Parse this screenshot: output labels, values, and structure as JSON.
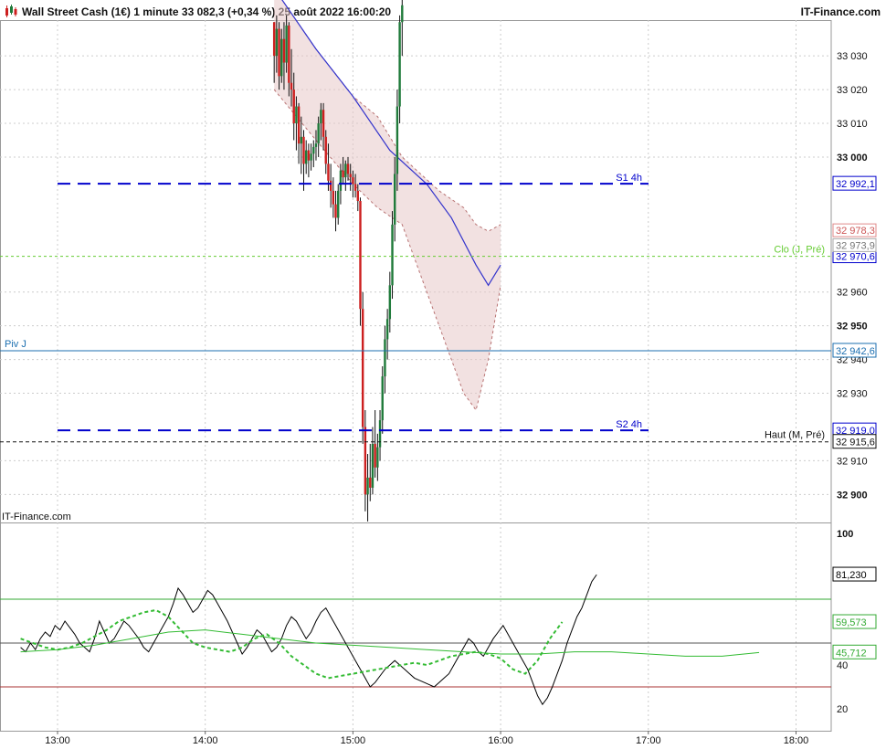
{
  "header": {
    "title": "Wall Street Cash (1€) 1 minute 33 082,3 (+0,34 %) 25 août 2022 16:00:20",
    "brand": "IT-Finance.com",
    "watermark": "IT-Finance.com"
  },
  "colors": {
    "up": "#1f7a3a",
    "down": "#cc1f1f",
    "mavg": "#3333cc",
    "pivot": "#1c6fb0",
    "level": "#0000cc",
    "close_line": "#66cc33",
    "bands": "#b87272",
    "osc": "#000000",
    "osc_fast": "#33bb33",
    "osc_slow": "#cc3333"
  },
  "chart_data": [
    {
      "type": "candlestick",
      "title": "Wall Street Cash (1€) 1 minute",
      "x_ticks": [
        "13:00",
        "14:00",
        "15:00",
        "16:00",
        "17:00",
        "18:00"
      ],
      "y_ticks": [
        {
          "v": 33030,
          "label": "33 030",
          "bold": false
        },
        {
          "v": 33020,
          "label": "33 020",
          "bold": false
        },
        {
          "v": 33010,
          "label": "33 010",
          "bold": false
        },
        {
          "v": 33000,
          "label": "33 000",
          "bold": true
        },
        {
          "v": 32960,
          "label": "32 960",
          "bold": false
        },
        {
          "v": 32950,
          "label": "32 950",
          "bold": true
        },
        {
          "v": 32940,
          "label": "32 940",
          "bold": false
        },
        {
          "v": 32930,
          "label": "32 930",
          "bold": false
        },
        {
          "v": 32910,
          "label": "32 910",
          "bold": false
        },
        {
          "v": 32900,
          "label": "32 900",
          "bold": true
        }
      ],
      "ylim": [
        32891.7,
        33040.6
      ],
      "levels": [
        {
          "name": "S1 4h",
          "value": 32992.1,
          "label": "32 992,1",
          "style": "dashed-blue"
        },
        {
          "name": "S2 4h",
          "value": 32919.0,
          "label": "32 919,0",
          "style": "dashed-blue"
        },
        {
          "name": "Clo (J, Pré)",
          "value": 32970.6,
          "label": "32 970,6",
          "style": "dotted-green"
        },
        {
          "name": "Piv J",
          "value": 32942.6,
          "label": "32 942,6",
          "style": "solid-pivot"
        },
        {
          "name": "Haut (M, Pré)",
          "value": 32915.6,
          "label": "32 915,6",
          "style": "dashed-black"
        }
      ],
      "extra_labels": [
        {
          "value": 32978.3,
          "label": "32 978,3"
        },
        {
          "value": 32973.9,
          "label": "32 973,9"
        }
      ],
      "candles_start": "14:28",
      "candles": [
        [
          33040,
          33040,
          33022,
          33030
        ],
        [
          33030,
          33042,
          33025,
          33038
        ],
        [
          33038,
          33040,
          33020,
          33024
        ],
        [
          33024,
          33038,
          33022,
          33035
        ],
        [
          33035,
          33040,
          33020,
          33028
        ],
        [
          33028,
          33042,
          33025,
          33039
        ],
        [
          33039,
          33040,
          33018,
          33022
        ],
        [
          33022,
          33032,
          33015,
          33020
        ],
        [
          33020,
          33025,
          33005,
          33010
        ],
        [
          33010,
          33018,
          33002,
          33015
        ],
        [
          33015,
          33016,
          32998,
          33004
        ],
        [
          33004,
          33012,
          32995,
          33006
        ],
        [
          33006,
          33008,
          32990,
          32998
        ],
        [
          32998,
          33005,
          32995,
          33002
        ],
        [
          33002,
          33004,
          32994,
          32999
        ],
        [
          32999,
          33004,
          32996,
          33001
        ],
        [
          33001,
          33005,
          32997,
          33003
        ],
        [
          33003,
          33008,
          32999,
          33004
        ],
        [
          33004,
          33012,
          33000,
          33010
        ],
        [
          33010,
          33016,
          33005,
          33014
        ],
        [
          33014,
          33016,
          33002,
          33006
        ],
        [
          33006,
          33008,
          32995,
          32998
        ],
        [
          32998,
          33004,
          32990,
          32993
        ],
        [
          32993,
          32998,
          32985,
          32990
        ],
        [
          32990,
          32994,
          32982,
          32986
        ],
        [
          32986,
          32990,
          32978,
          32982
        ],
        [
          32982,
          32992,
          32980,
          32990
        ],
        [
          32990,
          32998,
          32986,
          32996
        ],
        [
          32996,
          33000,
          32992,
          32994
        ],
        [
          32994,
          32999,
          32990,
          32998
        ],
        [
          32998,
          33000,
          32993,
          32995
        ],
        [
          32995,
          32998,
          32990,
          32994
        ],
        [
          32994,
          32996,
          32988,
          32992
        ],
        [
          32992,
          32995,
          32988,
          32990
        ],
        [
          32990,
          32992,
          32984,
          32987
        ],
        [
          32987,
          32988,
          32950,
          32955
        ],
        [
          32955,
          32960,
          32915,
          32920
        ],
        [
          32920,
          32925,
          32895,
          32900
        ],
        [
          32900,
          32912,
          32892,
          32905
        ],
        [
          32905,
          32915,
          32898,
          32902
        ],
        [
          32902,
          32920,
          32900,
          32915
        ],
        [
          32915,
          32925,
          32905,
          32908
        ],
        [
          32908,
          32918,
          32904,
          32914
        ],
        [
          32914,
          32925,
          32910,
          32922
        ],
        [
          32922,
          32938,
          32918,
          32935
        ],
        [
          32935,
          32950,
          32930,
          32946
        ],
        [
          32946,
          32955,
          32940,
          32952
        ],
        [
          32952,
          32966,
          32948,
          32962
        ],
        [
          32962,
          32984,
          32958,
          32980
        ],
        [
          32980,
          33000,
          32975,
          32995
        ],
        [
          32995,
          33020,
          32990,
          33015
        ],
        [
          33015,
          33042,
          33010,
          33040
        ],
        [
          33040,
          33050,
          33030,
          33045
        ]
      ],
      "mavg": [
        [
          "14:28",
          33050
        ],
        [
          "14:45",
          33032
        ],
        [
          "15:00",
          33018
        ],
        [
          "15:15",
          33002
        ],
        [
          "15:30",
          32992
        ],
        [
          "15:40",
          32982
        ],
        [
          "15:50",
          32968
        ],
        [
          "15:55",
          32962
        ],
        [
          "16:00",
          32968
        ]
      ],
      "band_upper": [
        [
          "14:28",
          33050
        ],
        [
          "14:45",
          33032
        ],
        [
          "15:00",
          33018
        ],
        [
          "15:10",
          33012
        ],
        [
          "15:20",
          33000
        ],
        [
          "15:35",
          32990
        ],
        [
          "15:45",
          32985
        ],
        [
          "15:50",
          32980
        ],
        [
          "15:55",
          32978
        ],
        [
          "16:00",
          32980
        ]
      ],
      "band_lower": [
        [
          "14:28",
          33020
        ],
        [
          "14:45",
          33005
        ],
        [
          "15:00",
          32992
        ],
        [
          "15:10",
          32985
        ],
        [
          "15:20",
          32980
        ],
        [
          "15:35",
          32950
        ],
        [
          "15:45",
          32930
        ],
        [
          "15:50",
          32925
        ],
        [
          "15:55",
          32940
        ],
        [
          "16:00",
          32962
        ]
      ]
    },
    {
      "type": "line",
      "title": "",
      "ylim": [
        10,
        105
      ],
      "y_ticks": [
        {
          "v": 100,
          "label": "100"
        },
        {
          "v": 40,
          "label": "40"
        },
        {
          "v": 20,
          "label": "20"
        }
      ],
      "hlines": [
        {
          "v": 70,
          "color": "#33aa33"
        },
        {
          "v": 50,
          "color": "#555555"
        },
        {
          "v": 30,
          "color": "#aa3333"
        }
      ],
      "value_labels": [
        {
          "v": 81.23,
          "label": "81,230",
          "color": "#000000"
        },
        {
          "v": 59.573,
          "label": "59,573",
          "color": "#33aa33"
        },
        {
          "v": 45.712,
          "label": "45,712",
          "color": "#33aa33"
        }
      ],
      "series": [
        {
          "role": "oscillator",
          "start": "12:45",
          "step_min": 2,
          "values": [
            48,
            46,
            50,
            47,
            52,
            55,
            53,
            58,
            56,
            60,
            57,
            54,
            50,
            48,
            46,
            52,
            60,
            55,
            50,
            52,
            56,
            60,
            58,
            55,
            52,
            48,
            46,
            50,
            54,
            58,
            62,
            68,
            75,
            72,
            68,
            64,
            66,
            70,
            74,
            72,
            68,
            64,
            60,
            55,
            50,
            45,
            48,
            52,
            56,
            54,
            50,
            46,
            48,
            52,
            58,
            62,
            60,
            56,
            52,
            55,
            60,
            64,
            66,
            62,
            58,
            54,
            50,
            46,
            42,
            38,
            34,
            30,
            32,
            35,
            38,
            40,
            42,
            40,
            38,
            36,
            34,
            33,
            32,
            31,
            30,
            32,
            34,
            36,
            40,
            44,
            48,
            52,
            50,
            46,
            44,
            48,
            52,
            55,
            58,
            54,
            50,
            46,
            42,
            38,
            32,
            26,
            22,
            25,
            30,
            36,
            42,
            50,
            56,
            62,
            66,
            72,
            78,
            81.2
          ]
        },
        {
          "role": "signal",
          "start": "12:45",
          "step_min": 5,
          "values": [
            52,
            50,
            48,
            47,
            48,
            50,
            53,
            56,
            60,
            62,
            64,
            65,
            62,
            56,
            50,
            48,
            47,
            46,
            48,
            52,
            54,
            50,
            44,
            40,
            36,
            34,
            35,
            36,
            37,
            38,
            39,
            40,
            41,
            40,
            42,
            44,
            45,
            46,
            45,
            43,
            38,
            36,
            42,
            52,
            59.6
          ]
        },
        {
          "role": "average",
          "start": "12:45",
          "step_min": 15,
          "values": [
            46,
            47,
            49,
            52,
            55,
            56,
            54,
            52,
            50,
            49,
            48,
            47,
            46,
            45,
            45,
            46,
            46,
            45,
            44,
            44,
            45.7
          ]
        }
      ]
    }
  ]
}
